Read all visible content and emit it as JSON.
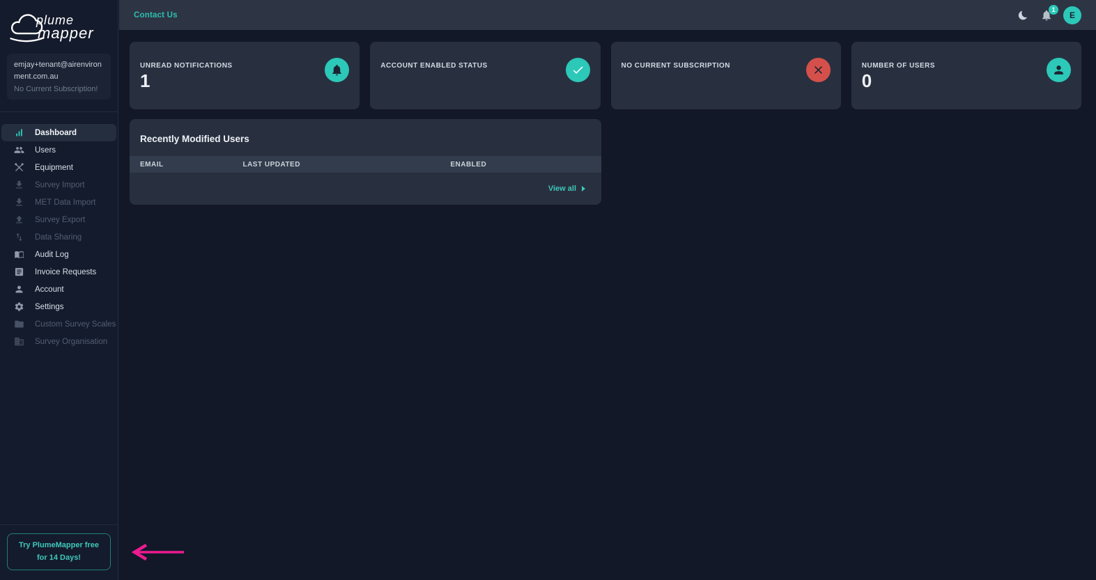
{
  "brand": {
    "name_line1": "plume",
    "name_line2": "mapper"
  },
  "sidebar": {
    "user_email": "emjay+tenant@airenvironment.com.au",
    "subscription_note": "No Current Subscription!",
    "items": [
      {
        "label": "Dashboard",
        "icon": "bar-chart-icon",
        "state": "active"
      },
      {
        "label": "Users",
        "icon": "people-icon",
        "state": "enabled"
      },
      {
        "label": "Equipment",
        "icon": "tools-icon",
        "state": "enabled"
      },
      {
        "label": "Survey Import",
        "icon": "download-icon",
        "state": "disabled"
      },
      {
        "label": "MET Data Import",
        "icon": "download-icon",
        "state": "disabled"
      },
      {
        "label": "Survey Export",
        "icon": "upload-icon",
        "state": "disabled"
      },
      {
        "label": "Data Sharing",
        "icon": "swap-vert-icon",
        "state": "disabled"
      },
      {
        "label": "Audit Log",
        "icon": "book-icon",
        "state": "enabled"
      },
      {
        "label": "Invoice Requests",
        "icon": "receipt-icon",
        "state": "enabled"
      },
      {
        "label": "Account",
        "icon": "person-icon",
        "state": "enabled"
      },
      {
        "label": "Settings",
        "icon": "gear-icon",
        "state": "enabled"
      },
      {
        "label": "Custom Survey Scales",
        "icon": "folder-icon",
        "state": "disabled"
      },
      {
        "label": "Survey Organisation",
        "icon": "organisation-icon",
        "state": "disabled"
      }
    ],
    "trial_button_label": "Try PlumeMapper free for 14 Days!"
  },
  "topbar": {
    "contact_link": "Contact Us",
    "notification_badge": "1",
    "avatar_initial": "E"
  },
  "stat_cards": [
    {
      "label": "UNREAD NOTIFICATIONS",
      "value": "1",
      "icon": "bell-icon",
      "icon_color": "#2cc8b8"
    },
    {
      "label": "ACCOUNT ENABLED STATUS",
      "value": "",
      "icon": "check-icon",
      "icon_color": "#2cc8b8"
    },
    {
      "label": "NO CURRENT SUBSCRIPTION",
      "value": "",
      "icon": "x-icon",
      "icon_color": "#d6504b"
    },
    {
      "label": "NUMBER OF USERS",
      "value": "0",
      "icon": "person-icon",
      "icon_color": "#2cc8b8"
    }
  ],
  "recent_users": {
    "title": "Recently Modified Users",
    "columns": [
      "EMAIL",
      "LAST UPDATED",
      "ENABLED"
    ],
    "rows": [],
    "view_all_label": "View all"
  },
  "colors": {
    "accent_teal": "#2cc8b8",
    "danger_red": "#d6504b",
    "annotation_pink": "#ed1a90",
    "background": "#121828",
    "sidebar": "#141b2c",
    "topbar": "#2d3544",
    "card": "#28303f"
  }
}
